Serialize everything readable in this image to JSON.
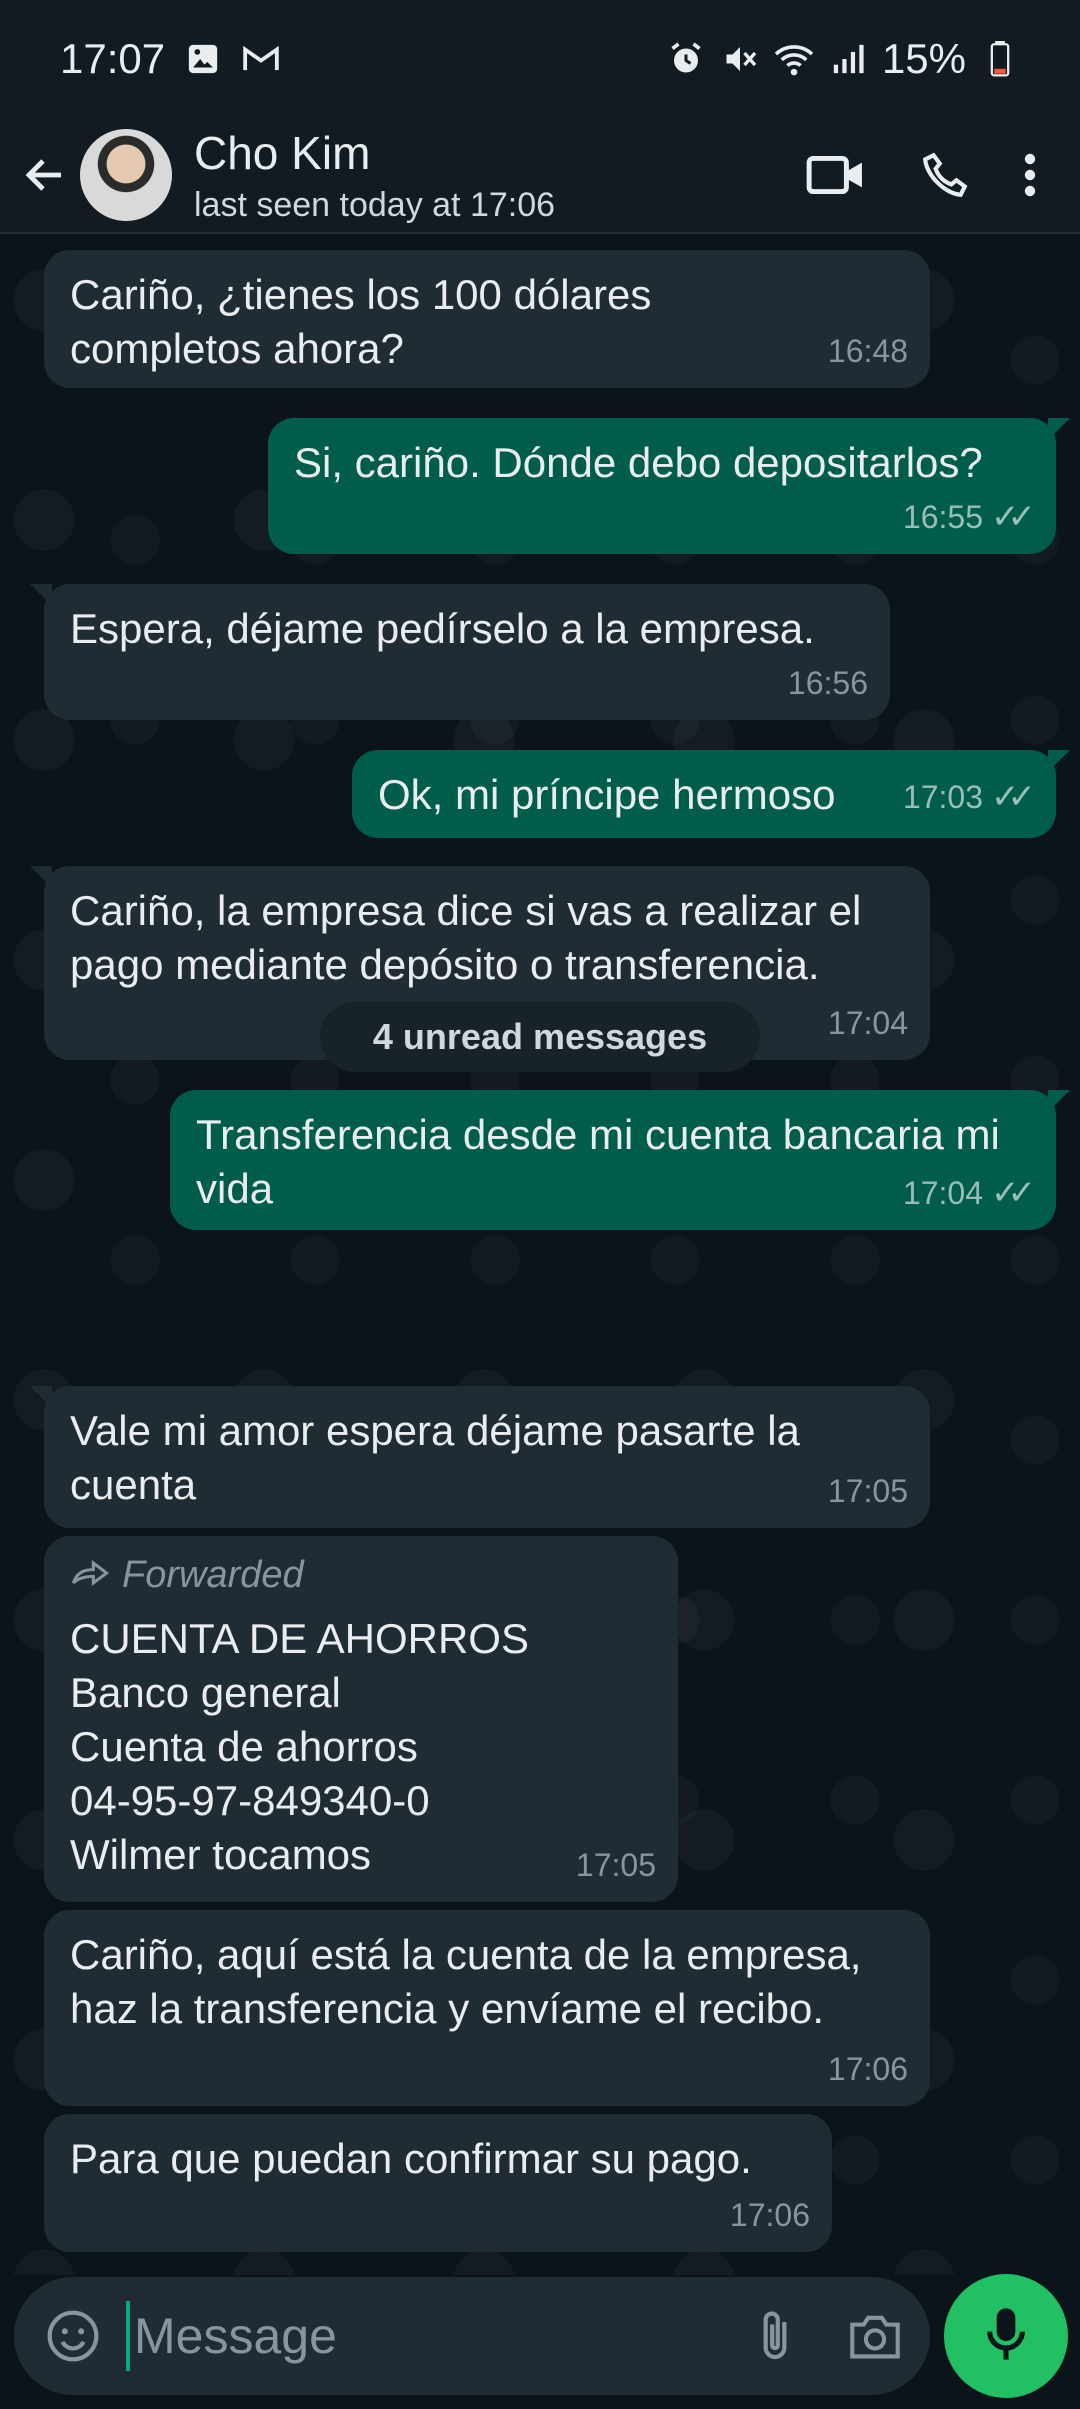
{
  "status_bar": {
    "time": "17:07",
    "battery": "15%"
  },
  "header": {
    "name": "Cho Kim",
    "subtitle": "last seen today at 17:06"
  },
  "messages": [
    {
      "dir": "in",
      "text": "Cariño, ¿tienes los 100 dólares completos ahora?",
      "time": "16:48"
    },
    {
      "dir": "out",
      "text": "Si, cariño. Dónde debo depositarlos?",
      "time": "16:55"
    },
    {
      "dir": "in",
      "text": "Espera, déjame pedírselo a la empresa.",
      "time": "16:56"
    },
    {
      "dir": "out",
      "text": "Ok, mi príncipe hermoso",
      "time": "17:03"
    },
    {
      "dir": "in",
      "text": "Cariño, la empresa dice si vas a realizar el pago mediante depósito o transferencia.",
      "time": "17:04"
    },
    {
      "dir": "out",
      "text": "Transferencia desde mi cuenta bancaria mi vida",
      "time": "17:04"
    },
    {
      "dir": "in",
      "text": "Vale mi amor espera déjame pasarte la cuenta",
      "time": "17:05"
    },
    {
      "dir": "in",
      "forwarded_label": "Forwarded",
      "lines": [
        "CUENTA DE AHORROS",
        "Banco general",
        "Cuenta de ahorros",
        "04-95-97-849340-0",
        "Wilmer tocamos"
      ],
      "time": "17:05"
    },
    {
      "dir": "in",
      "text": "Cariño, aquí está la cuenta de la empresa, haz la transferencia y envíame el recibo.",
      "time": "17:06"
    },
    {
      "dir": "in",
      "text": "Para que puedan confirmar su pago.",
      "time": "17:06"
    }
  ],
  "unread_label": "4 unread messages",
  "composer": {
    "placeholder": "Message"
  },
  "colors": {
    "incoming": "#202c33",
    "outgoing": "#005c4b",
    "accent": "#21c063"
  },
  "icons": [
    "back-arrow-icon",
    "video-call-icon",
    "phone-icon",
    "more-vert-icon",
    "emoji-icon",
    "attach-icon",
    "camera-icon",
    "mic-icon",
    "forward-icon",
    "read-ticks-icon"
  ]
}
